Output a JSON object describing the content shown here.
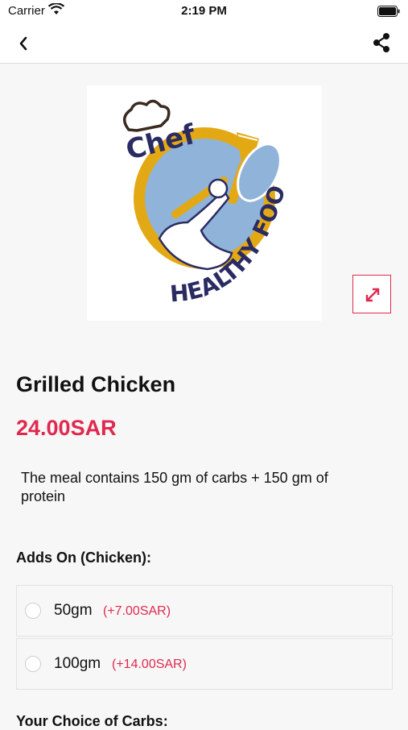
{
  "status_bar": {
    "carrier": "Carrier",
    "time": "2:19 PM"
  },
  "product": {
    "logo_text_top": "Chef",
    "logo_text_bottom": "HEALTHY FOOD",
    "title": "Grilled Chicken",
    "price": "24.00SAR",
    "description": "The meal contains 150 gm of carbs + 150 gm of protein"
  },
  "addons": {
    "title": "Adds On (Chicken):",
    "options": [
      {
        "label": "50gm",
        "price": "(+7.00SAR)"
      },
      {
        "label": "100gm",
        "price": "(+14.00SAR)"
      }
    ]
  },
  "next_section": {
    "title": "Your Choice of Carbs:"
  },
  "colors": {
    "accent": "#e0294f",
    "logo_navy": "#2b2b63",
    "logo_gold": "#e3a915",
    "logo_blue": "#8fb3d9"
  }
}
